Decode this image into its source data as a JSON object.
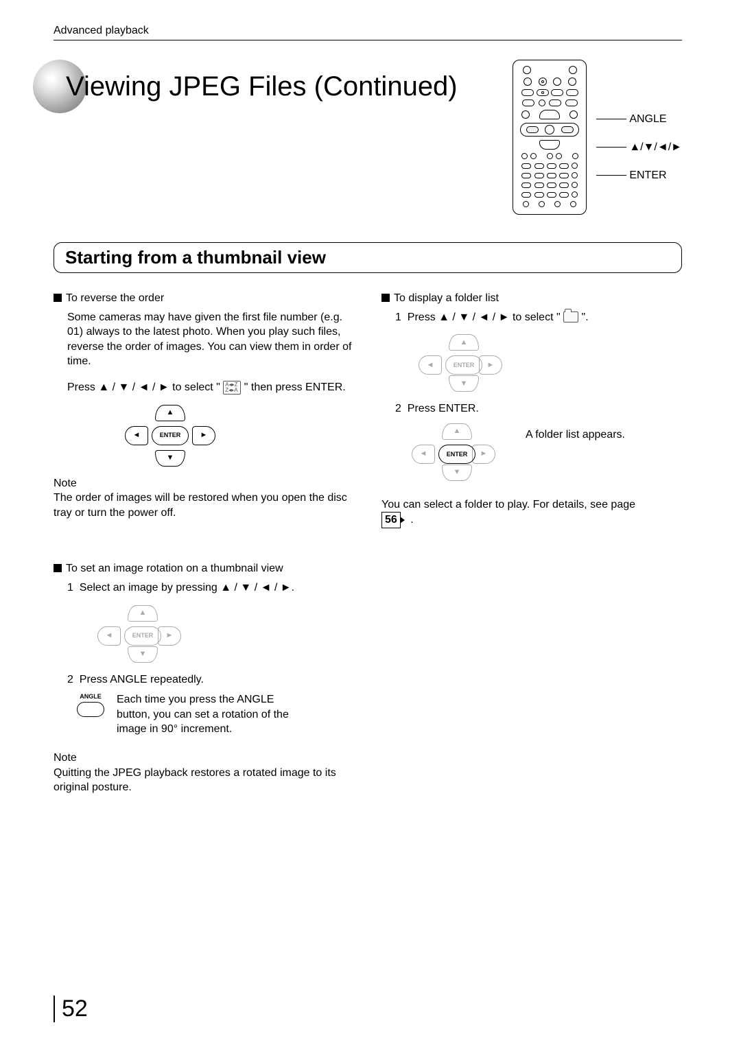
{
  "header": {
    "section_label": "Advanced playback"
  },
  "title": "Viewing JPEG Files (Continued)",
  "remote_labels": {
    "angle": "ANGLE",
    "dpad": "▲/▼/◄/►",
    "enter": "ENTER"
  },
  "section_heading": "Starting from a thumbnail view",
  "left_col": {
    "reverse": {
      "heading": "To reverse the order",
      "body": "Some cameras may have given the first file number (e.g. 01) always to the latest photo. When you play such files, reverse the order of images. You can view them in order of time.",
      "instruction_pre": "Press ▲ / ▼ / ◄ / ► to select \" ",
      "instruction_post": " \" then press ENTER.",
      "enter_label": "ENTER",
      "note_label": "Note",
      "note_body": "The order of images will be restored when you open the disc tray or turn the power off."
    },
    "rotate": {
      "heading": "To set an image rotation on a thumbnail view",
      "step1_num": "1",
      "step1": "Select an image by pressing ▲ / ▼ / ◄ / ►.",
      "enter_label": "ENTER",
      "step2_num": "2",
      "step2": "Press ANGLE repeatedly.",
      "angle_btn_label": "ANGLE",
      "step2_body": "Each time you press the ANGLE button, you can set a rotation of the image in 90° increment.",
      "note_label": "Note",
      "note_body": "Quitting the JPEG playback restores a rotated image to its original posture."
    }
  },
  "right_col": {
    "folder": {
      "heading": "To display a folder list",
      "step1_num": "1",
      "step1_pre": "Press ▲ / ▼ / ◄ / ► to select \" ",
      "step1_post": " \".",
      "enter_label": "ENTER",
      "step2_num": "2",
      "step2": "Press ENTER.",
      "appears": "A folder list appears.",
      "footer_pre": "You can select a folder to play.  For details, see page ",
      "page_ref": "56",
      "footer_post": "."
    }
  },
  "page_number": "52"
}
